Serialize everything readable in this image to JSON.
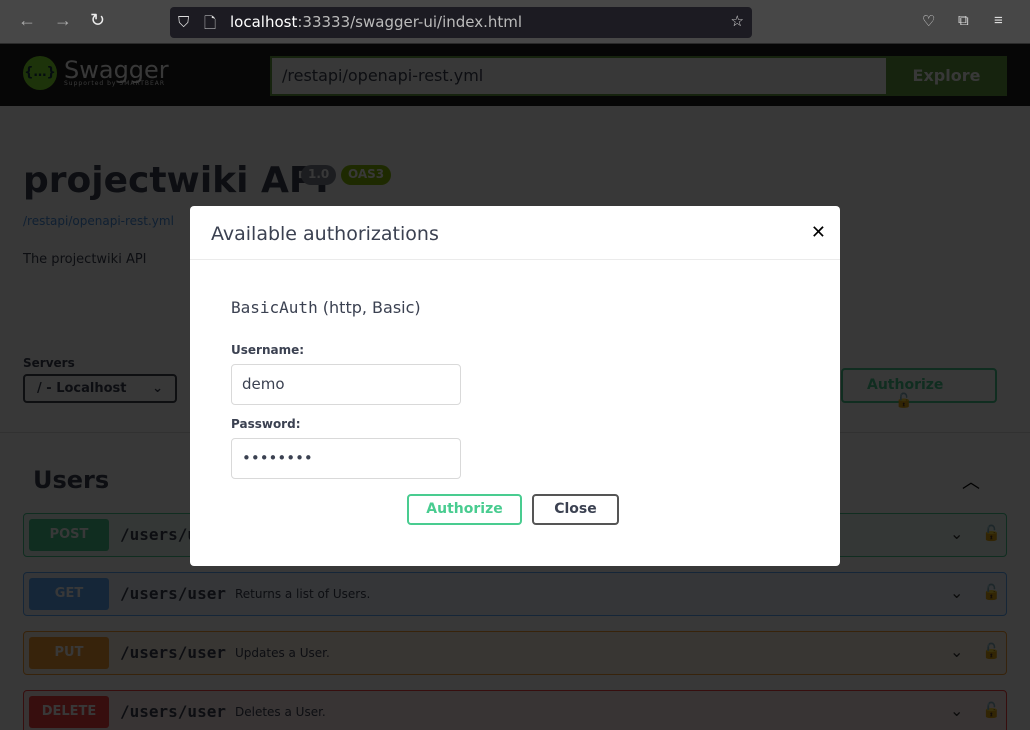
{
  "browser": {
    "url_host": "localhost",
    "url_rest": ":33333/swagger-ui/index.html"
  },
  "topbar": {
    "brand": "Swagger",
    "brand_sub": "Supported by SMARTBEAR",
    "spec_url": "/restapi/openapi-rest.yml",
    "explore": "Explore"
  },
  "info": {
    "title": "projectwiki API",
    "version": "1.0",
    "oas": "OAS3",
    "link": "/restapi/openapi-rest.yml",
    "description": "The projectwiki API"
  },
  "servers": {
    "label": "Servers",
    "selected": "/ - Localhost"
  },
  "authorize_label": "Authorize",
  "tag": "Users",
  "operations": [
    {
      "method": "POST",
      "path": "/users/user",
      "summary": "",
      "color": "#49cc90"
    },
    {
      "method": "GET",
      "path": "/users/user",
      "summary": "Returns a list of Users.",
      "color": "#61affe"
    },
    {
      "method": "PUT",
      "path": "/users/user",
      "summary": "Updates a User.",
      "color": "#fca130"
    },
    {
      "method": "DELETE",
      "path": "/users/user",
      "summary": "Deletes a User.",
      "color": "#f93e3e"
    }
  ],
  "modal": {
    "title": "Available authorizations",
    "scheme_name": "BasicAuth",
    "scheme_type": "(http, Basic)",
    "username_label": "Username:",
    "username": "demo",
    "password_label": "Password:",
    "password": "••••••••",
    "authorize": "Authorize",
    "close": "Close"
  }
}
